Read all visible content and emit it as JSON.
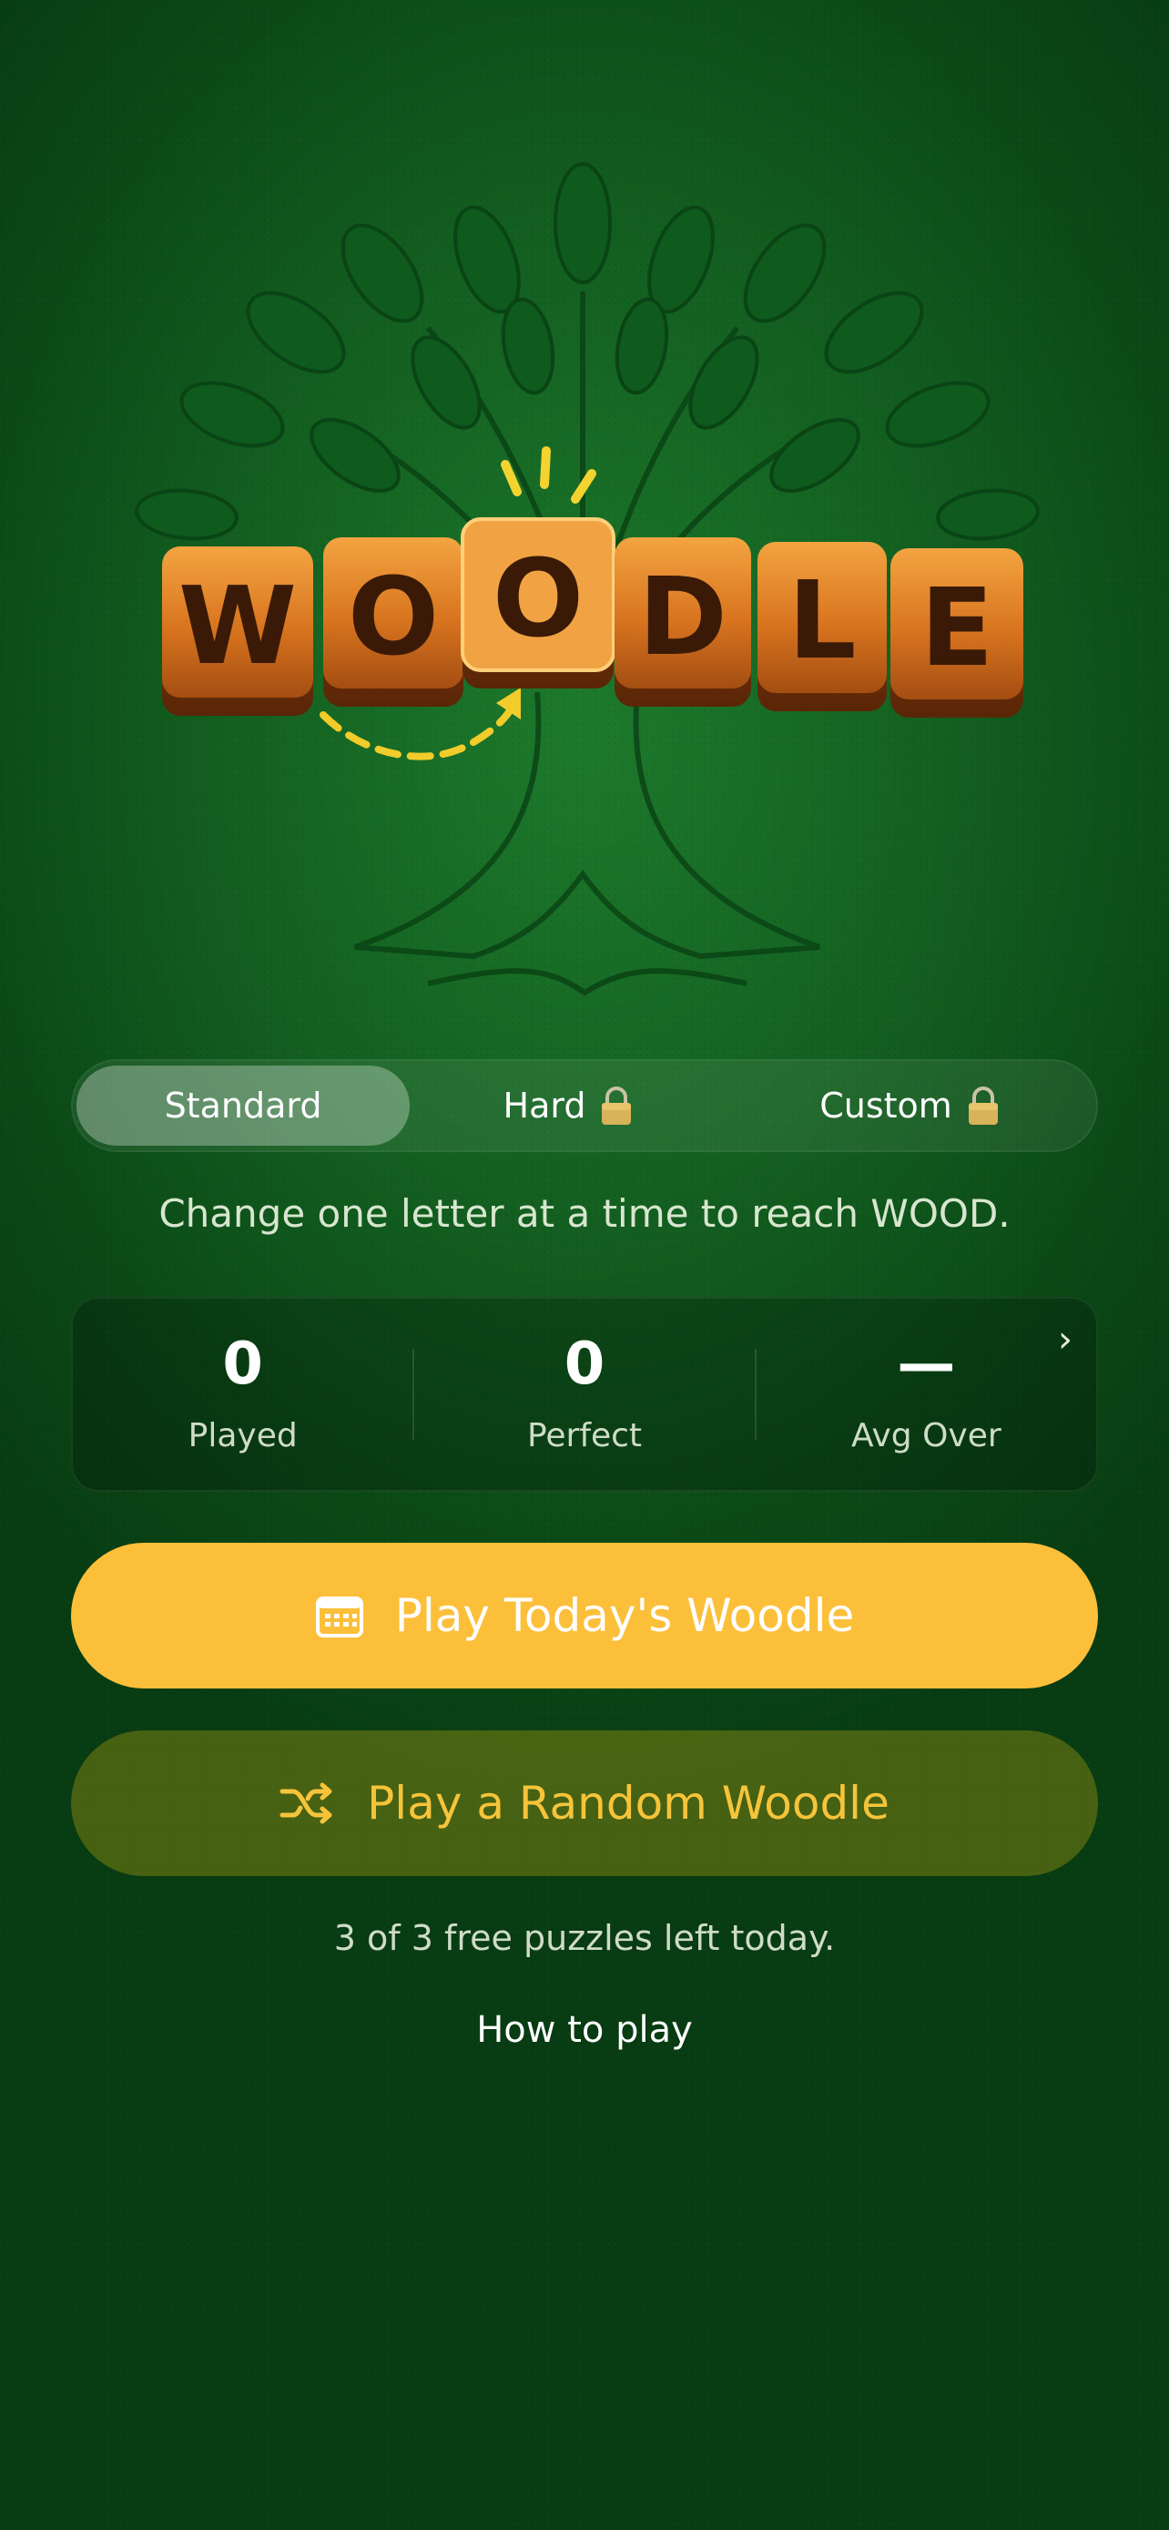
{
  "logo": {
    "letters": [
      "W",
      "O",
      "O",
      "D",
      "L",
      "E"
    ],
    "wordmark": "WOODLE"
  },
  "modes": [
    {
      "label": "Standard",
      "locked": false,
      "selected": true
    },
    {
      "label": "Hard",
      "locked": true,
      "selected": false
    },
    {
      "label": "Custom",
      "locked": true,
      "selected": false
    }
  ],
  "instructions": "Change one letter at a time to reach WOOD.",
  "stats": {
    "played": {
      "value": "0",
      "label": "Played"
    },
    "perfect": {
      "value": "0",
      "label": "Perfect"
    },
    "avg_over": {
      "value": "—",
      "label": "Avg Over"
    }
  },
  "buttons": {
    "today_label": "Play Today's Woodle",
    "random_label": "Play a Random Woodle"
  },
  "free_puzzles_text": "3 of 3 free puzzles left today.",
  "how_to_play_label": "How to play",
  "colors": {
    "background": "#135f20",
    "primary_button": "#fcbf3a",
    "secondary_text": "#f6c43a"
  }
}
